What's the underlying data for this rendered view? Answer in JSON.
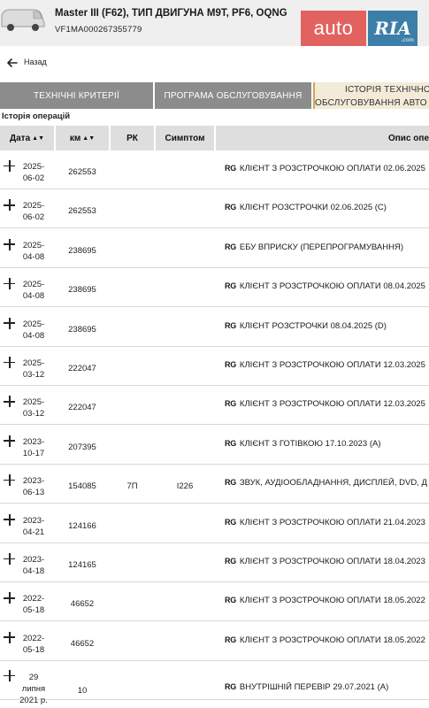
{
  "vehicle": {
    "title": "Master III (F62), ТИП ДВИГУНА M9T, PF6, OQNG",
    "vin": "VF1MA000267355779"
  },
  "logo": {
    "auto": "auto",
    "ria": "RIA",
    "com": ".com"
  },
  "nav": {
    "back_label": "Назад"
  },
  "tabs": [
    {
      "label": "ТЕХНІЧНІ КРИТЕРІЇ"
    },
    {
      "label": "ПРОГРАМА ОБСЛУГОВУВАННЯ"
    },
    {
      "label_line1": "ІСТОРІЯ ТЕХНІЧНОГ",
      "label_line2": "ОБСЛУГОВУВАННЯ АВТО"
    }
  ],
  "section_title": "Історія операцій",
  "table": {
    "headers": {
      "date": "Дата",
      "km": "км",
      "rk": "РК",
      "symptom": "Симптом",
      "desc": "Опис опе"
    },
    "rows": [
      {
        "date1": "2025-",
        "date2": "06-02",
        "km": "262553",
        "rk": "",
        "symptom": "",
        "tag": "RG",
        "desc": "КЛІЄНТ З РОЗСТРОЧКОЮ ОПЛАТИ 02.06.2025"
      },
      {
        "date1": "2025-",
        "date2": "06-02",
        "km": "262553",
        "rk": "",
        "symptom": "",
        "tag": "RG",
        "desc": "КЛІЄНТ РОЗСТРОЧКИ 02.06.2025 (C)"
      },
      {
        "date1": "2025-",
        "date2": "04-08",
        "km": "238695",
        "rk": "",
        "symptom": "",
        "tag": "RG",
        "desc": "ЕБУ ВПРИСКУ (ПЕРЕПРОГРАМУВАННЯ)"
      },
      {
        "date1": "2025-",
        "date2": "04-08",
        "km": "238695",
        "rk": "",
        "symptom": "",
        "tag": "RG",
        "desc": "КЛІЄНТ З РОЗСТРОЧКОЮ ОПЛАТИ 08.04.2025"
      },
      {
        "date1": "2025-",
        "date2": "04-08",
        "km": "238695",
        "rk": "",
        "symptom": "",
        "tag": "RG",
        "desc": "КЛІЄНТ РОЗСТРОЧКИ 08.04.2025 (D)"
      },
      {
        "date1": "2025-",
        "date2": "03-12",
        "km": "222047",
        "rk": "",
        "symptom": "",
        "tag": "RG",
        "desc": "КЛІЄНТ З РОЗСТРОЧКОЮ ОПЛАТИ 12.03.2025"
      },
      {
        "date1": "2025-",
        "date2": "03-12",
        "km": "222047",
        "rk": "",
        "symptom": "",
        "tag": "RG",
        "desc": "КЛІЄНТ З РОЗСТРОЧКОЮ ОПЛАТИ 12.03.2025"
      },
      {
        "date1": "2023-",
        "date2": "10-17",
        "km": "207395",
        "rk": "",
        "symptom": "",
        "tag": "RG",
        "desc": "КЛІЄНТ З ГОТІВКОЮ 17.10.2023 (A)"
      },
      {
        "date1": "2023-",
        "date2": "06-13",
        "km": "154085",
        "rk": "7П",
        "symptom": "I226",
        "tag": "RG",
        "desc": "ЗВУК, АУДІООБЛАДНАННЯ, ДИСПЛЕЙ, DVD, Д"
      },
      {
        "date1": "2023-",
        "date2": "04-21",
        "km": "124166",
        "rk": "",
        "symptom": "",
        "tag": "RG",
        "desc": "КЛІЄНТ З РОЗСТРОЧКОЮ ОПЛАТИ 21.04.2023"
      },
      {
        "date1": "2023-",
        "date2": "04-18",
        "km": "124165",
        "rk": "",
        "symptom": "",
        "tag": "RG",
        "desc": "КЛІЄНТ З РОЗСТРОЧКОЮ ОПЛАТИ 18.04.2023"
      },
      {
        "date1": "2022-",
        "date2": "05-18",
        "km": "46652",
        "rk": "",
        "symptom": "",
        "tag": "RG",
        "desc": "КЛІЄНТ З РОЗСТРОЧКОЮ ОПЛАТИ 18.05.2022"
      },
      {
        "date1": "2022-",
        "date2": "05-18",
        "km": "46652",
        "rk": "",
        "symptom": "",
        "tag": "RG",
        "desc": "КЛІЄНТ З РОЗСТРОЧКОЮ ОПЛАТИ 18.05.2022"
      },
      {
        "date1": "29",
        "date2": "липня",
        "date3": "2021 р.",
        "km": "10",
        "rk": "",
        "symptom": "",
        "tag": "RG",
        "desc": "ВНУТРІШНІЙ ПЕРЕВІР 29.07.2021 (A)"
      }
    ]
  },
  "colors": {
    "tab_bg": "#8c8c8c",
    "active_tab_bg": "#f3ead8",
    "active_tab_border": "#cfa94d",
    "header_bg": "#dedede",
    "auto_logo": "#e2625f",
    "ria_logo": "#3b7fa8"
  }
}
